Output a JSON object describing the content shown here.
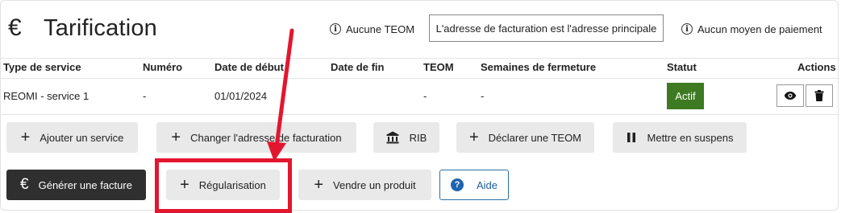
{
  "header": {
    "title_icon": "€",
    "title": "Tarification",
    "teom_status": "Aucune TEOM",
    "billing_address_label": "L'adresse de facturation est l'adresse principale",
    "payment_status": "Aucun moyen de paiement"
  },
  "table": {
    "columns": [
      "Type de service",
      "Numéro",
      "Date de début",
      "Date de fin",
      "TEOM",
      "Semaines de fermeture",
      "Statut",
      "Actions"
    ],
    "rows": [
      {
        "service_type": "REOMI - service 1",
        "number": "-",
        "start_date": "01/01/2024",
        "end_date": "",
        "teom": "-",
        "closure_weeks": "-",
        "status": "Actif",
        "actions": [
          "eye-icon",
          "trash-icon"
        ]
      }
    ]
  },
  "buttons_row1": [
    {
      "label": "Ajouter un service",
      "icon": "plus-icon"
    },
    {
      "label": "Changer l'adresse de facturation",
      "icon": "plus-icon"
    },
    {
      "label": "RIB",
      "icon": "bank-icon"
    },
    {
      "label": "Déclarer une TEOM",
      "icon": "plus-icon"
    },
    {
      "label": "Mettre en suspens",
      "icon": "pause-icon"
    }
  ],
  "buttons_row2": [
    {
      "label": "Générer une facture",
      "icon": "euro-icon"
    },
    {
      "label": "Régularisation",
      "icon": "plus-icon"
    },
    {
      "label": "Vendre un produit",
      "icon": "plus-icon"
    },
    {
      "label": "Aide",
      "icon": "question-circle-icon"
    }
  ],
  "colors": {
    "status_active": "#3d7a22",
    "primary_dark": "#2f2f2f",
    "annotation_red": "#e3162f",
    "help_blue": "#1f64b0"
  }
}
